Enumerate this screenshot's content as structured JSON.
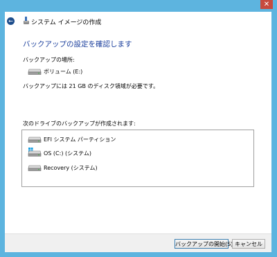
{
  "window": {
    "title": "システム イメージの作成",
    "close_label": "✕"
  },
  "heading": "バックアップの設定を確認します",
  "location": {
    "label": "バックアップの場所:",
    "drive_name": "ボリューム (E:)",
    "drive_icon": "hard-drive-icon"
  },
  "space_note": "バックアップには 21 GB のディスク領域が必要です。",
  "drives_list": {
    "label": "次のドライブのバックアップが作成されます:",
    "items": [
      {
        "label": "EFI システム パーティション",
        "icon": "hard-drive-icon"
      },
      {
        "label": "OS (C:) (システム)",
        "icon": "windows-drive-icon"
      },
      {
        "label": "Recovery (システム)",
        "icon": "hard-drive-icon"
      }
    ]
  },
  "buttons": {
    "start": "バックアップの開始(S)",
    "cancel": "キャンセル"
  },
  "colors": {
    "window_frame": "#5db4df",
    "heading": "#1a3e9c",
    "close_button": "#c74a3e"
  }
}
